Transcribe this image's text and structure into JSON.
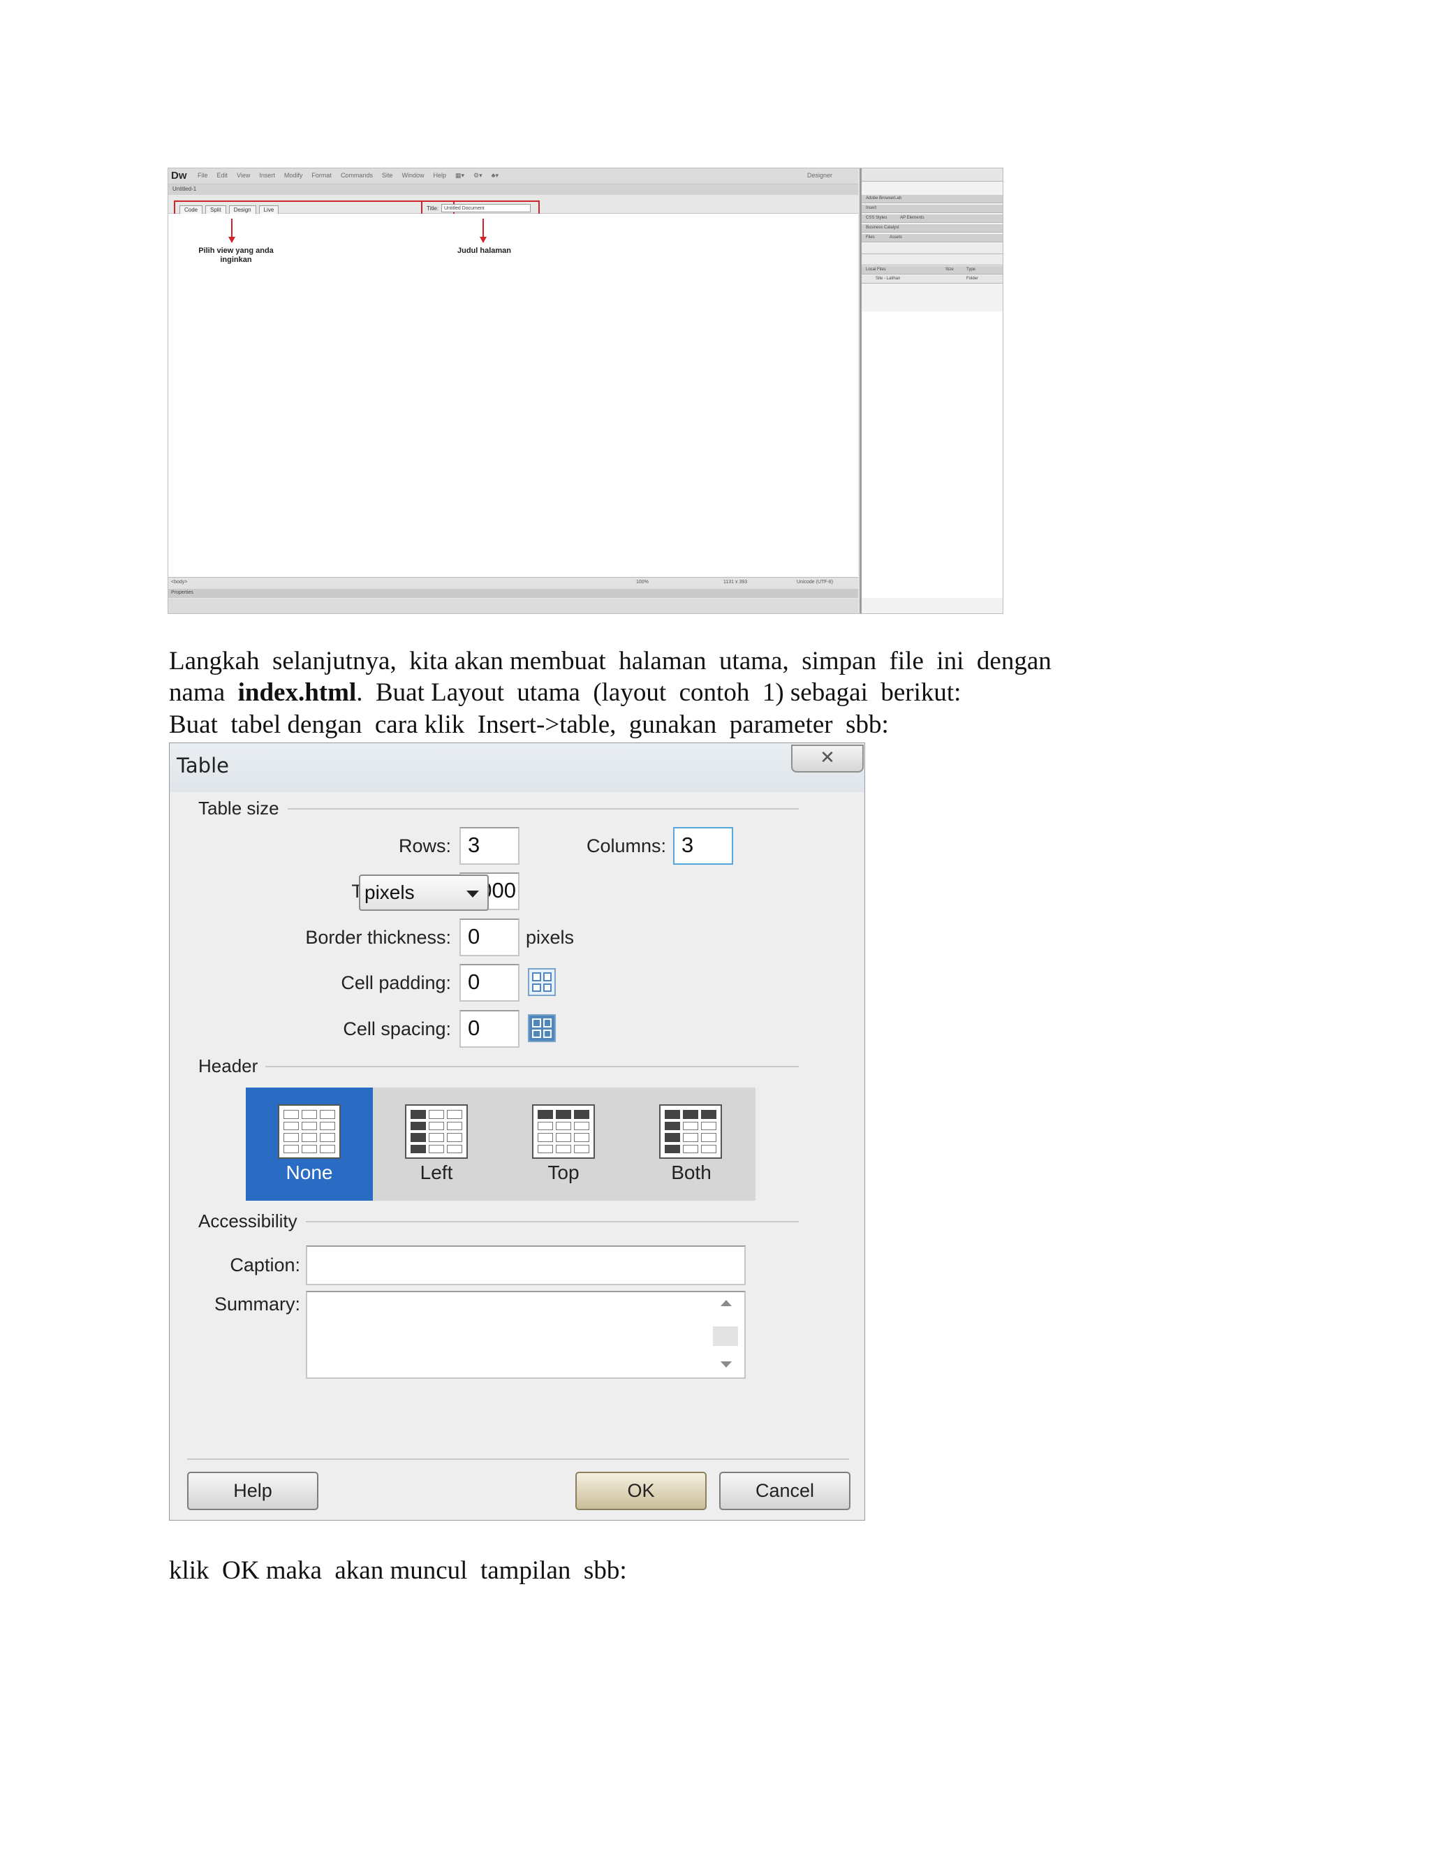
{
  "dreamweaver": {
    "logo": "Dw",
    "menu": [
      "File",
      "Edit",
      "View",
      "Insert",
      "Modify",
      "Format",
      "Commands",
      "Site",
      "Window",
      "Help"
    ],
    "workspace": "Designer",
    "doc_tab": "Untitled-1",
    "view_buttons": [
      "Code",
      "Split",
      "Design",
      "Live"
    ],
    "title_label": "Title:",
    "title_value": "Untitled Document",
    "annotation_view": "Pilih view yang anda inginkan",
    "annotation_title": "Judul halaman",
    "status_zoom": "100%",
    "status_size": "1131 x 393",
    "status_encoding": "Unicode (UTF-8)",
    "panel_items": [
      "Adobe BrowserLab",
      "Insert",
      "CSS Styles",
      "AP Elements",
      "Business Catalyst",
      "Files",
      "Assets"
    ],
    "files_columns": [
      "Local Files",
      "Size",
      "Type"
    ],
    "files_row": "Site - Latihan",
    "files_row_type": "Folder",
    "properties_label": "Properties"
  },
  "paragraphs": {
    "line1": "Langkah  selanjutnya,  kita akan membuat  halaman  utama,  simpan  file  ini  dengan",
    "line2_pre": "nama  ",
    "line2_bold": "index.html",
    "line2_post": ".  Buat Layout  utama  (layout  contoh  1) sebagai  berikut:",
    "line3": "Buat  tabel dengan  cara klik  Insert->table,  gunakan  parameter  sbb:",
    "line4": "klik  OK maka  akan muncul  tampilan  sbb:"
  },
  "dialog": {
    "title": "Table",
    "close_symbol": "✕",
    "section_size": "Table size",
    "rows_label": "Rows:",
    "rows_value": "3",
    "columns_label": "Columns:",
    "columns_value": "3",
    "width_label": "Table width:",
    "width_value": "1000",
    "width_unit": "pixels",
    "border_label": "Border thickness:",
    "border_value": "0",
    "border_unit": "pixels",
    "padding_label": "Cell padding:",
    "padding_value": "0",
    "spacing_label": "Cell spacing:",
    "spacing_value": "0",
    "section_header": "Header",
    "header_options": [
      "None",
      "Left",
      "Top",
      "Both"
    ],
    "header_selected": "None",
    "section_access": "Accessibility",
    "caption_label": "Caption:",
    "caption_value": "",
    "summary_label": "Summary:",
    "summary_value": "",
    "help_button": "Help",
    "ok_button": "OK",
    "cancel_button": "Cancel",
    "selected_color": "#2a6cc4"
  }
}
